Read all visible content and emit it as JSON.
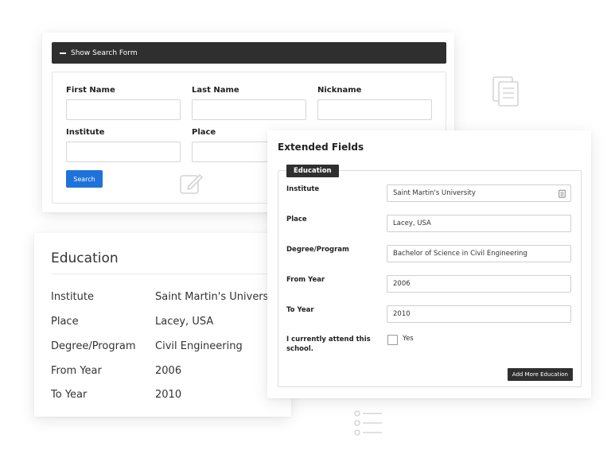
{
  "search_form": {
    "toggle_label": "Show Search Form",
    "fields": [
      {
        "label": "First Name"
      },
      {
        "label": "Last Name"
      },
      {
        "label": "Nickname"
      },
      {
        "label": "Institute"
      },
      {
        "label": "Place"
      }
    ],
    "search_button": "Search"
  },
  "education_card": {
    "title": "Education",
    "rows": [
      {
        "label": "Institute",
        "value": "Saint Martin's University"
      },
      {
        "label": "Place",
        "value": "Lacey, USA"
      },
      {
        "label": "Degree/Program",
        "value": "Civil Engineering"
      },
      {
        "label": "From Year",
        "value": "2006"
      },
      {
        "label": "To Year",
        "value": "2010"
      }
    ]
  },
  "extended_fields": {
    "title": "Extended Fields",
    "legend": "Education",
    "fields": [
      {
        "label": "Institute",
        "value": "Saint Martin's University"
      },
      {
        "label": "Place",
        "value": "Lacey, USA"
      },
      {
        "label": "Degree/Program",
        "value": "Bachelor of Science in Civil Engineering"
      },
      {
        "label": "From Year",
        "value": "2006"
      },
      {
        "label": "To Year",
        "value": "2010"
      }
    ],
    "attend_label": "I currently attend this school.",
    "attend_option": "Yes",
    "add_button": "Add More Education"
  },
  "icons": {
    "copy": "copy-icon",
    "edit": "edit-icon",
    "list": "list-icon",
    "clipboard": "clipboard-icon"
  }
}
